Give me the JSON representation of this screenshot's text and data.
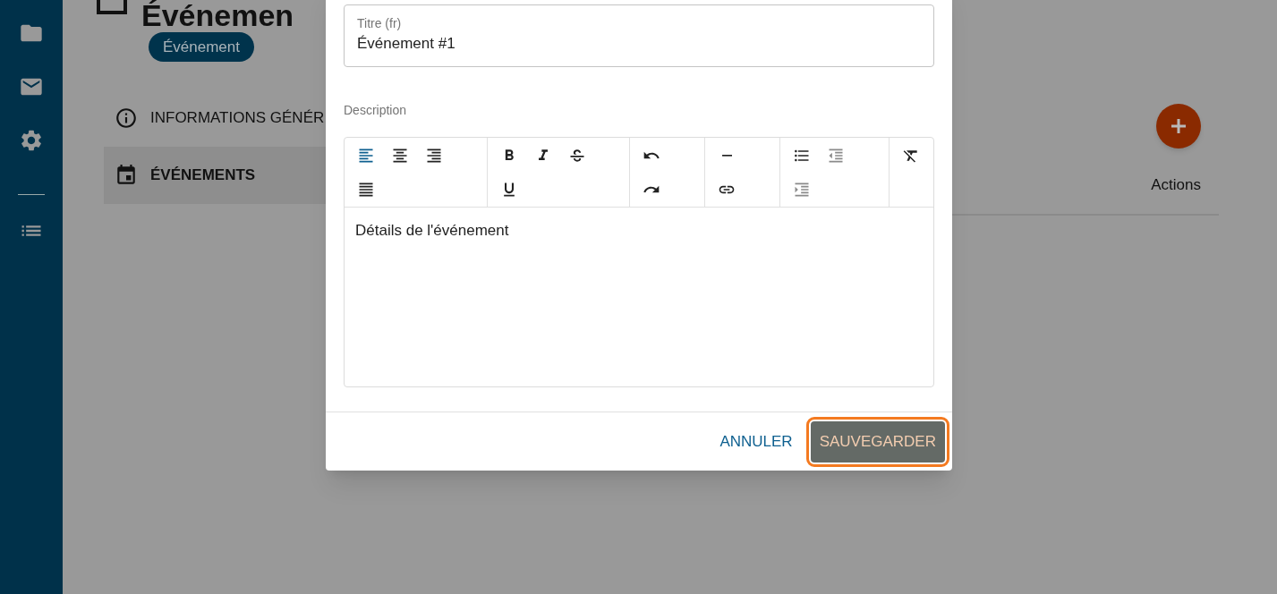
{
  "sidebar": {
    "items": [
      {
        "kind": "folder"
      },
      {
        "kind": "mail"
      },
      {
        "kind": "settings"
      },
      {
        "kind": "divider"
      },
      {
        "kind": "list"
      }
    ]
  },
  "page": {
    "title": "Événemen",
    "tag": "Événement",
    "nav": [
      {
        "label": "INFORMATIONS GÉNÉR",
        "kind": "info",
        "selected": false
      },
      {
        "label": "ÉVÉNEMENTS",
        "kind": "event",
        "selected": true
      }
    ],
    "table": {
      "columns": [
        "Actions"
      ]
    }
  },
  "dialog": {
    "fields": [
      {
        "label": "Titre (fr)",
        "value": "Événement #1"
      }
    ],
    "description": {
      "label": "Description",
      "content": "Détails de l'événement",
      "toolbar": [
        {
          "buttons": [
            {
              "kind": "align-left",
              "active": true,
              "disabled": false
            },
            {
              "kind": "align-center",
              "active": false,
              "disabled": false
            },
            {
              "kind": "align-right",
              "active": false,
              "disabled": false
            },
            {
              "kind": "align-justify",
              "active": false,
              "disabled": false
            }
          ]
        },
        {
          "buttons": [
            {
              "kind": "bold",
              "active": false,
              "disabled": false
            },
            {
              "kind": "italic",
              "active": false,
              "disabled": false
            },
            {
              "kind": "strikethrough",
              "active": false,
              "disabled": false
            },
            {
              "kind": "underline",
              "active": false,
              "disabled": false
            }
          ]
        },
        {
          "buttons": [
            {
              "kind": "undo",
              "active": false,
              "disabled": false
            },
            {
              "kind": "redo",
              "active": false,
              "disabled": false
            }
          ]
        },
        {
          "buttons": [
            {
              "kind": "horizontal-rule",
              "active": false,
              "disabled": false
            },
            {
              "kind": "link",
              "active": false,
              "disabled": false
            }
          ]
        },
        {
          "buttons": [
            {
              "kind": "bullet-list",
              "active": false,
              "disabled": false
            },
            {
              "kind": "outdent",
              "active": false,
              "disabled": true
            },
            {
              "kind": "indent",
              "active": false,
              "disabled": true
            }
          ]
        },
        {
          "buttons": [
            {
              "kind": "clear-format",
              "active": false,
              "disabled": false
            }
          ]
        }
      ]
    },
    "buttons": [
      {
        "label": "ANNULER",
        "kind": "text",
        "focused": false
      },
      {
        "label": "SAUVEGARDER",
        "kind": "filled",
        "focused": true
      }
    ]
  }
}
